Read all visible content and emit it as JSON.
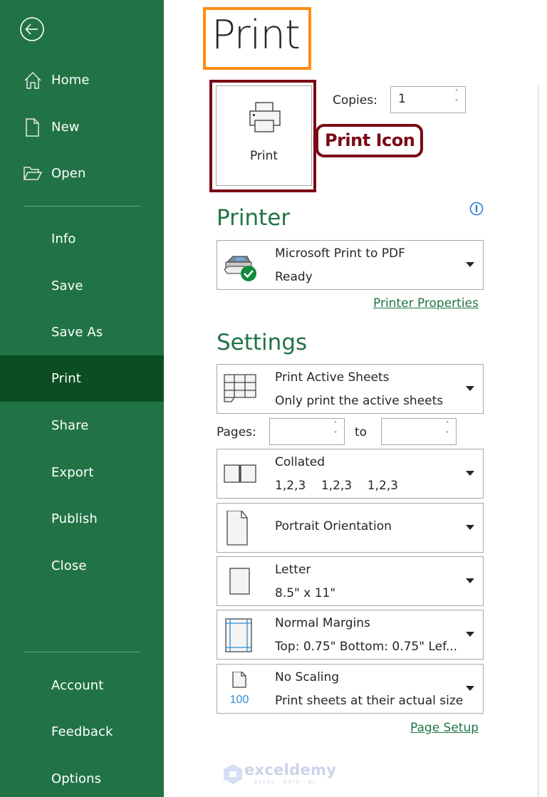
{
  "sidebar": {
    "back_label": "Back",
    "items": [
      {
        "label": "Home",
        "icon": "home-icon"
      },
      {
        "label": "New",
        "icon": "new-document-icon"
      },
      {
        "label": "Open",
        "icon": "folder-open-icon"
      },
      {
        "label": "Info"
      },
      {
        "label": "Save"
      },
      {
        "label": "Save As"
      },
      {
        "label": "Print",
        "active": true
      },
      {
        "label": "Share"
      },
      {
        "label": "Export"
      },
      {
        "label": "Publish"
      },
      {
        "label": "Close"
      },
      {
        "label": "Account"
      },
      {
        "label": "Feedback"
      },
      {
        "label": "Options"
      }
    ],
    "colors": {
      "background": "#217346",
      "active": "#0a4e22"
    }
  },
  "main": {
    "title": "Print",
    "print_button_label": "Print",
    "copies": {
      "label": "Copies:",
      "value": "1"
    },
    "annotation": "Print Icon",
    "printer": {
      "heading": "Printer",
      "name": "Microsoft Print to PDF",
      "status": "Ready",
      "properties_link": "Printer Properties"
    },
    "settings": {
      "heading": "Settings",
      "scope": {
        "title": "Print Active Sheets",
        "subtitle": "Only print the active sheets"
      },
      "pages": {
        "label": "Pages:",
        "from": "",
        "to_label": "to",
        "to": ""
      },
      "collation": {
        "title": "Collated",
        "subtitle": "1,2,3    1,2,3    1,2,3"
      },
      "orientation": {
        "title": "Portrait Orientation"
      },
      "paper": {
        "title": "Letter",
        "subtitle": "8.5\" x 11\""
      },
      "margins": {
        "title": "Normal Margins",
        "subtitle": "Top: 0.75\" Bottom: 0.75\" Lef..."
      },
      "scaling": {
        "title": "No Scaling",
        "subtitle": "Print sheets at their actual size",
        "icon_text": "100"
      },
      "page_setup_link": "Page Setup"
    },
    "accent_color": "#217346"
  },
  "watermark": {
    "name": "exceldemy",
    "tagline": "EXCEL · DATA · BI"
  }
}
